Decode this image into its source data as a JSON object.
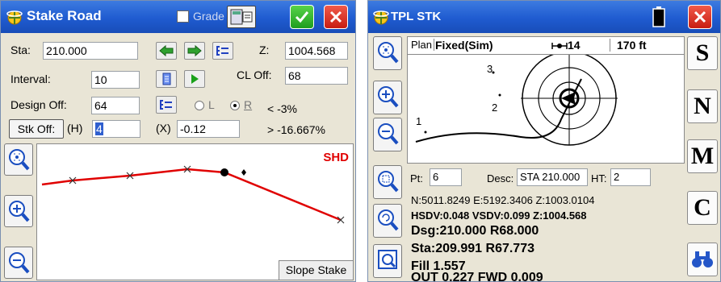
{
  "left": {
    "title": "Stake Road",
    "grade_label": "Grade",
    "sta_label": "Sta:",
    "sta_value": "210.000",
    "z_label": "Z:",
    "z_value": "1004.568",
    "interval_label": "Interval:",
    "interval_value": "10",
    "cl_off_label": "CL Off:",
    "cl_off_value": "68",
    "design_off_label": "Design Off:",
    "design_off_value": "64",
    "radio_l": "L",
    "radio_r": "R",
    "slope_left": "< -3%",
    "slope_right": "> -16.667%",
    "stk_off_label": "Stk Off:",
    "h_label": "(H)",
    "h_value": "4",
    "x_label": "(X)",
    "x_value": "-0.12",
    "shd_label": "SHD",
    "slope_stake_label": "Slope Stake"
  },
  "right": {
    "title": "TPL STK",
    "plan_label": "Plan",
    "status": "Fixed(Sim)",
    "sats": "14",
    "distance": "170 ft",
    "point_labels": [
      "3",
      "2",
      "1"
    ],
    "pt_label": "Pt:",
    "pt_value": "6",
    "desc_label": "Desc:",
    "desc_value": "STA 210.000",
    "ht_label": "HT:",
    "ht_value": "2",
    "coords": "N:5011.8249    E:5192.3406    Z:1003.0104",
    "precision": "HSDV:0.048 VSDV:0.099 Z:1004.568",
    "design": "Dsg:210.000 R68.000",
    "station": "Sta:209.991 R67.773",
    "fill": "Fill 1.557",
    "out_fwd": "OUT 0.227 FWD 0.009",
    "side_letters": [
      "S",
      "N",
      "M",
      "C"
    ]
  },
  "colors": {
    "title_blue": "#1f5bd0",
    "design_line": "#e00000",
    "shd": "#e00000"
  }
}
